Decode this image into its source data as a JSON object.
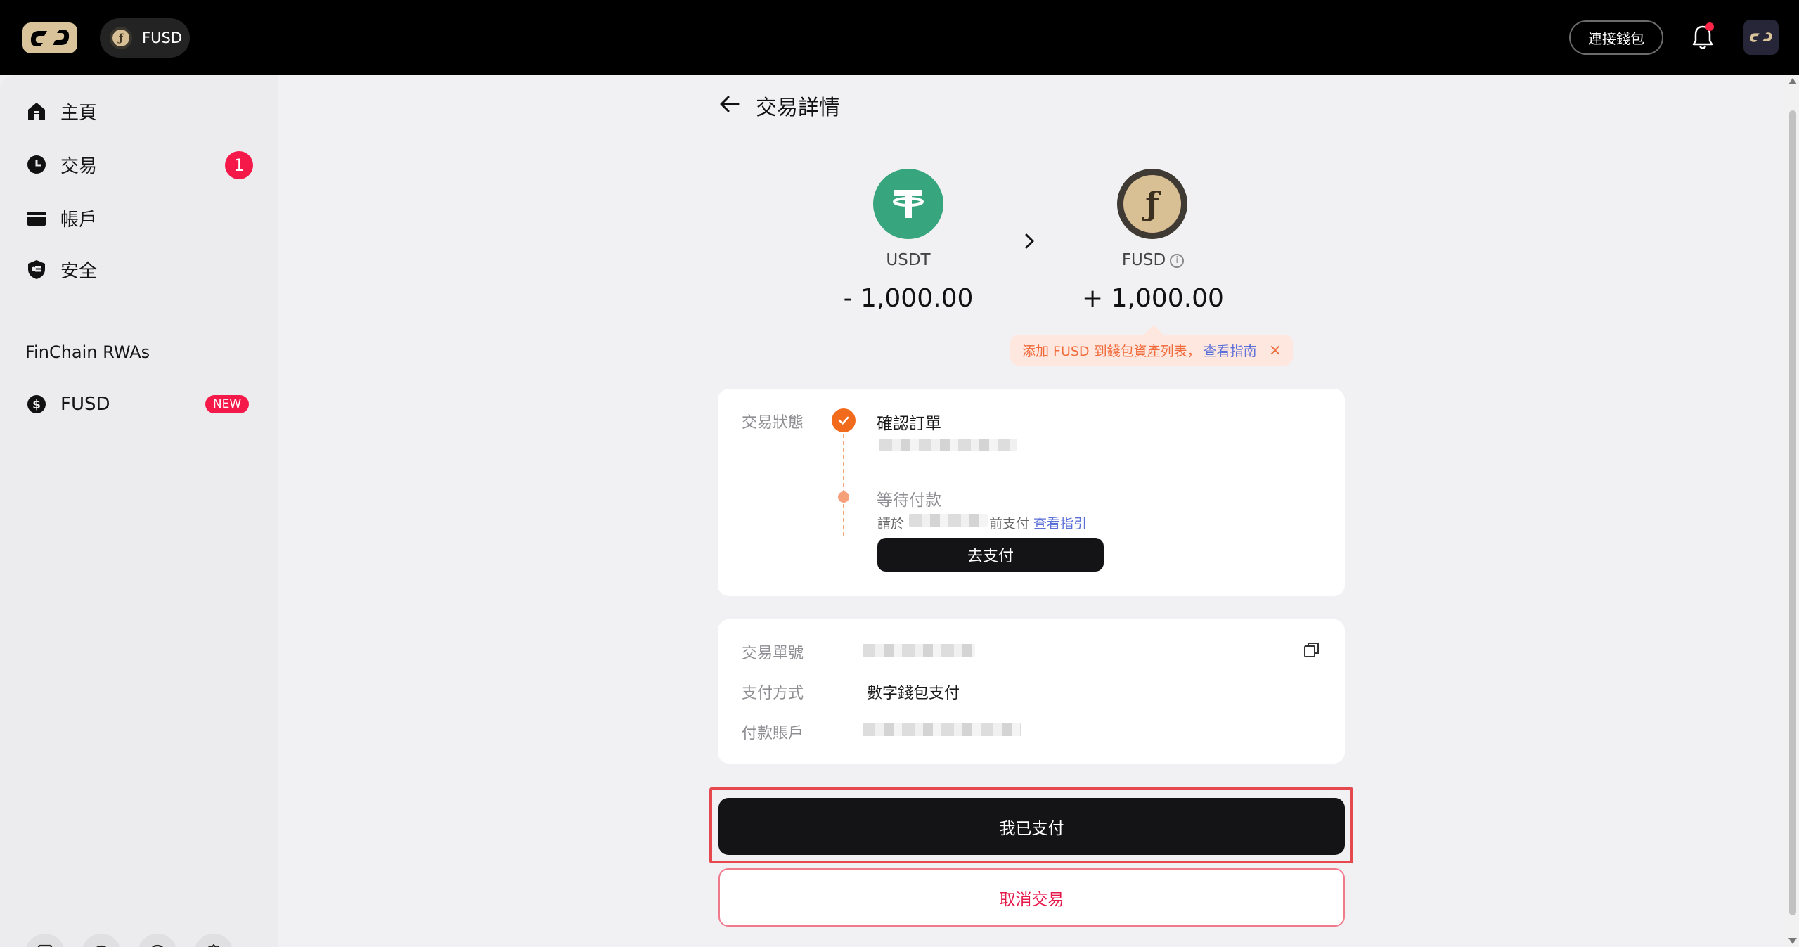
{
  "header": {
    "token_label": "FUSD",
    "connect_wallet_label": "連接錢包",
    "notification_dot_color": "#ff2448"
  },
  "sidebar": {
    "items": [
      {
        "label": "主頁",
        "icon": "home-icon"
      },
      {
        "label": "交易",
        "icon": "clock-icon",
        "badge": "1"
      },
      {
        "label": "帳戶",
        "icon": "card-icon"
      },
      {
        "label": "安全",
        "icon": "shield-icon"
      }
    ],
    "section_label": "FinChain RWAs",
    "fusd_item": {
      "label": "FUSD",
      "badge": "NEW",
      "icon": "coin-icon"
    },
    "tools": [
      "document-icon",
      "headset-icon",
      "help-icon",
      "settings-icon"
    ]
  },
  "page": {
    "title": "交易詳情"
  },
  "swap": {
    "from": {
      "symbol": "USDT",
      "amount": "- 1,000.00",
      "color": "#37a57d"
    },
    "to": {
      "symbol": "FUSD",
      "amount": "+ 1,000.00",
      "color": "#d9bf94"
    }
  },
  "tip": {
    "text": "添加 FUSD 到錢包資產列表，",
    "link": "查看指南",
    "close": "×"
  },
  "status": {
    "label": "交易狀態",
    "step1_title": "確認訂單",
    "step2_title": "等待付款",
    "step2_prefix": "請於",
    "step2_suffix": "前支付",
    "step2_link": "查看指引",
    "pay_button": "去支付"
  },
  "details": {
    "order_no_label": "交易單號",
    "method_label": "支付方式",
    "method_value": "數字錢包支付",
    "account_label": "付款賬戶"
  },
  "actions": {
    "paid_button": "我已支付",
    "cancel_button": "取消交易"
  }
}
